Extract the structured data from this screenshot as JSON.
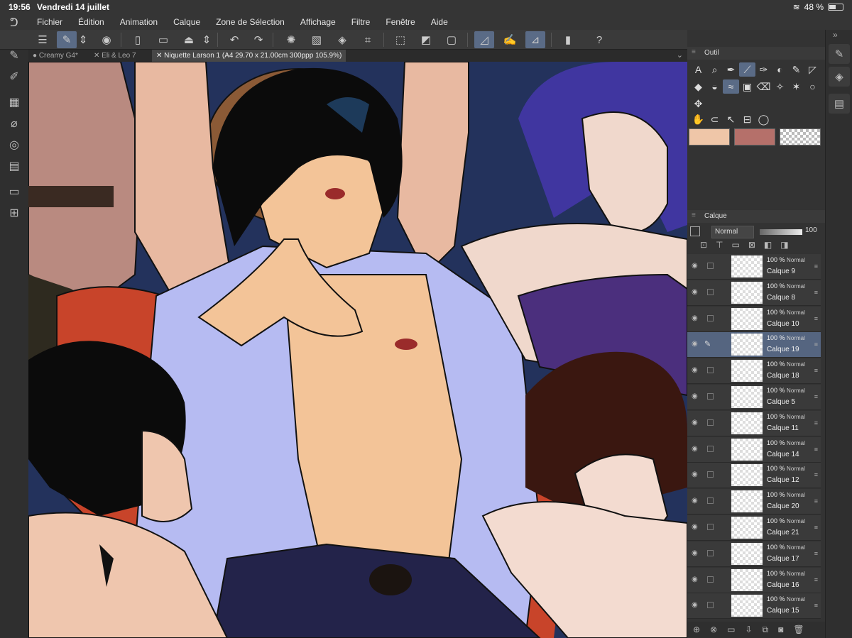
{
  "status": {
    "time": "19:56",
    "date": "Vendredi 14 juillet",
    "battery": "48 %",
    "battery_level": 0.48
  },
  "menu": {
    "items": [
      "Fichier",
      "Édition",
      "Animation",
      "Calque",
      "Zone de Sélection",
      "Affichage",
      "Filtre",
      "Fenêtre",
      "Aide"
    ]
  },
  "tabs": [
    {
      "label": "● Creamy G4*"
    },
    {
      "label": "✕ Eli & Leo 7"
    },
    {
      "label": "✕ Niquette Larson 1 (A4 29.70 x 21.00cm 300ppp 105.9%)"
    }
  ],
  "tool_panel": {
    "title": "Outil"
  },
  "colors": {
    "main": "#efc6a8",
    "sub": "#b5706a",
    "canvas_bg": "#23325c",
    "accent": "#5a6b86"
  },
  "layer_panel": {
    "title": "Calque",
    "blend_mode": "Normal",
    "opacity": "100",
    "layers": [
      {
        "opacity": "100 %",
        "mode": "Normal",
        "name": "Calque 9"
      },
      {
        "opacity": "100 %",
        "mode": "Normal",
        "name": "Calque 8"
      },
      {
        "opacity": "100 %",
        "mode": "Normal",
        "name": "Calque 10"
      },
      {
        "opacity": "100 %",
        "mode": "Normal",
        "name": "Calque 19"
      },
      {
        "opacity": "100 %",
        "mode": "Normal",
        "name": "Calque 18"
      },
      {
        "opacity": "100 %",
        "mode": "Normal",
        "name": "Calque 5"
      },
      {
        "opacity": "100 %",
        "mode": "Normal",
        "name": "Calque 11"
      },
      {
        "opacity": "100 %",
        "mode": "Normal",
        "name": "Calque 14"
      },
      {
        "opacity": "100 %",
        "mode": "Normal",
        "name": "Calque 12"
      },
      {
        "opacity": "100 %",
        "mode": "Normal",
        "name": "Calque 20"
      },
      {
        "opacity": "100 %",
        "mode": "Normal",
        "name": "Calque 21"
      },
      {
        "opacity": "100 %",
        "mode": "Normal",
        "name": "Calque 17"
      },
      {
        "opacity": "100 %",
        "mode": "Normal",
        "name": "Calque 16"
      },
      {
        "opacity": "100 %",
        "mode": "Normal",
        "name": "Calque 15"
      }
    ]
  }
}
